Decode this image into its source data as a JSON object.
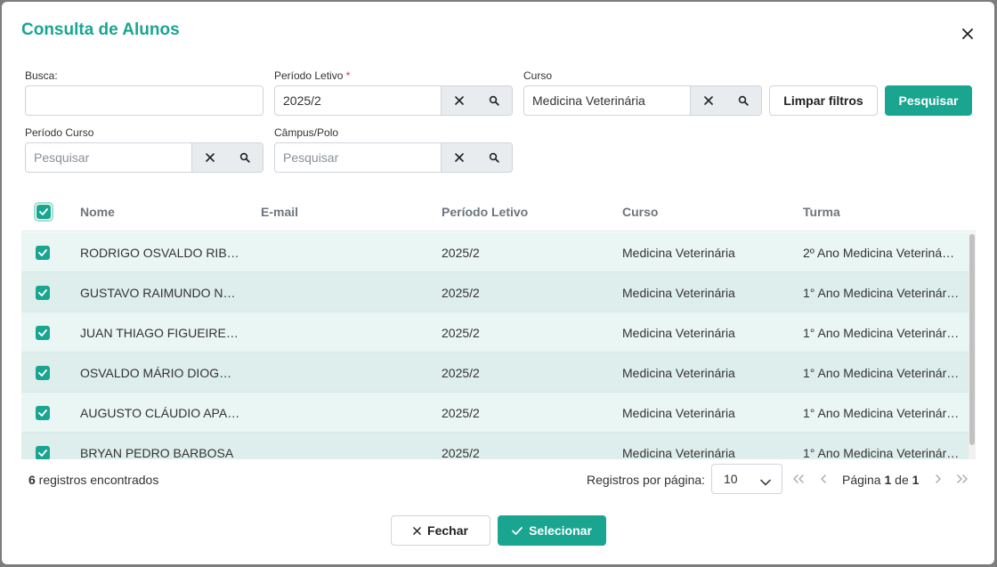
{
  "modal": {
    "title": "Consulta de Alunos"
  },
  "filters": {
    "busca": {
      "label": "Busca:",
      "value": ""
    },
    "periodo_letivo": {
      "label": "Período Letivo",
      "required_mark": "*",
      "value": "2025/2"
    },
    "curso": {
      "label": "Curso",
      "value": "Medicina Veterinária"
    },
    "periodo_curso": {
      "label": "Período Curso",
      "placeholder": "Pesquisar"
    },
    "campus_polo": {
      "label": "Câmpus/Polo",
      "placeholder": "Pesquisar"
    },
    "clear_label": "Limpar filtros",
    "search_label": "Pesquisar"
  },
  "table": {
    "columns": [
      "Nome",
      "E-mail",
      "Período Letivo",
      "Curso",
      "Turma"
    ],
    "rows": [
      {
        "nome": "RODRIGO OSVALDO RIBEI…",
        "email": "",
        "periodo": "2025/2",
        "curso": "Medicina Veterinária",
        "turma": "2º Ano Medicina Veteriná…"
      },
      {
        "nome": "GUSTAVO RAIMUNDO NA…",
        "email": "",
        "periodo": "2025/2",
        "curso": "Medicina Veterinária",
        "turma": "1° Ano Medicina Veterinár…"
      },
      {
        "nome": "JUAN THIAGO FIGUEIREDO",
        "email": "",
        "periodo": "2025/2",
        "curso": "Medicina Veterinária",
        "turma": "1° Ano Medicina Veterinár…"
      },
      {
        "nome": "OSVALDO MÁRIO DIOGO …",
        "email": "",
        "periodo": "2025/2",
        "curso": "Medicina Veterinária",
        "turma": "1° Ano Medicina Veterinár…"
      },
      {
        "nome": "AUGUSTO CLÁUDIO APAR…",
        "email": "",
        "periodo": "2025/2",
        "curso": "Medicina Veterinária",
        "turma": "1° Ano Medicina Veterinár…"
      },
      {
        "nome": "BRYAN PEDRO BARBOSA",
        "email": "",
        "periodo": "2025/2",
        "curso": "Medicina Veterinária",
        "turma": "1° Ano Medicina Veterinár…"
      }
    ]
  },
  "footer": {
    "count": "6",
    "count_suffix": " registros encontrados",
    "per_page_label": "Registros por página:",
    "per_page_value": "10",
    "page_prefix": "Página ",
    "page_current": "1",
    "page_of": " de ",
    "page_total": "1"
  },
  "actions": {
    "close_label": "Fechar",
    "select_label": "Selecionar"
  },
  "colors": {
    "accent": "#1aa591",
    "row_odd": "#e9f6f3",
    "row_even": "#deeeec"
  }
}
